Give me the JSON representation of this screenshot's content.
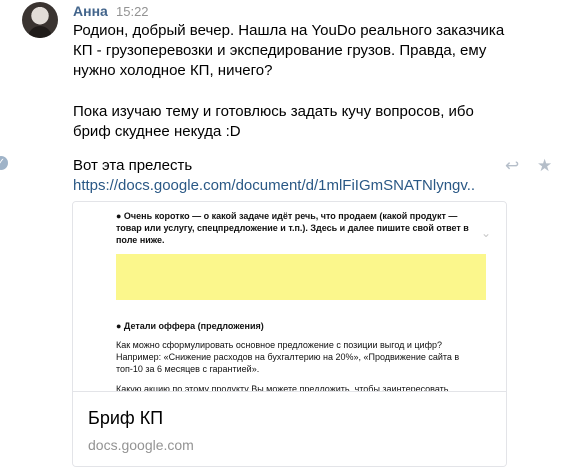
{
  "message": {
    "author": "Анна",
    "time": "15:22",
    "lines": [
      "Родион, добрый вечер. Нашла на YouDo реального заказчика",
      "КП - грузоперевозки и экспедирование грузов. Правда, ему",
      "нужно холодное КП, ничего?",
      "Пока изучаю тему и готовлюсь задать кучу вопросов, ибо",
      "бриф скуднее некуда :D",
      "Вот эта прелесть"
    ],
    "link_text": "https://docs.google.com/document/d/1mlFiIGmSNATNlyngv.."
  },
  "preview": {
    "lines": [
      "● Очень коротко — о какой задаче идёт речь, что продаем (какой продукт —",
      "товар или услугу, спецпредложение и т.п.). Здесь и далее пишите свой ответ в",
      "поле ниже.",
      "● Детали оффера (предложения)",
      "Как можно сформулировать основное предложение с позиции выгод и цифр?",
      "Например: «Снижение расходов на бухгалтерию на 20%», «Продвижение сайта в",
      "топ-10 за 6 месяцев с гарантией».",
      "Какую акцию по этому продукту Вы можете предложить, чтобы заинтересовать"
    ],
    "highlight_color": "#fbf78c"
  },
  "card": {
    "title": "Бриф КП",
    "domain": "docs.google.com"
  },
  "icons": {
    "read_marker": "check-circle-icon",
    "reply": "reply-icon",
    "favorite": "star-icon",
    "expand": "chevron-down-icon"
  }
}
